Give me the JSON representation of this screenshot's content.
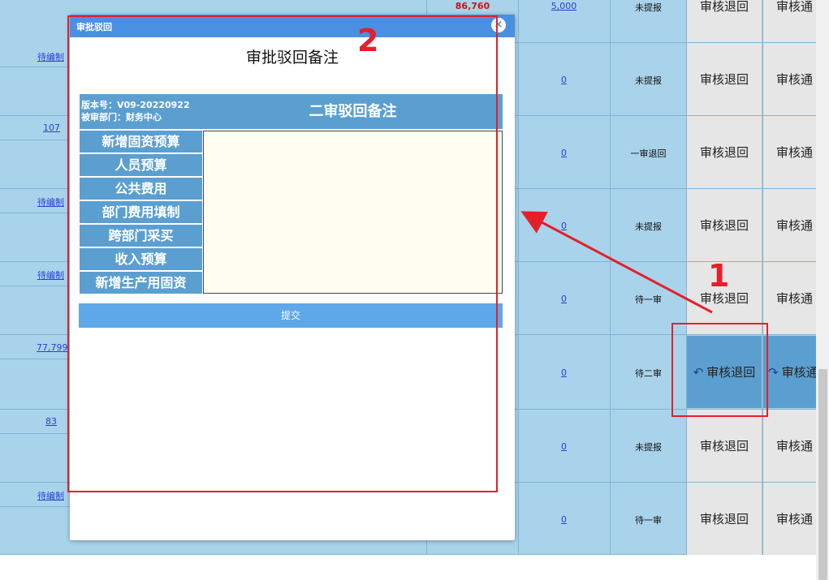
{
  "table": {
    "top_amount": "86,760",
    "top_amount_color": "#d01010",
    "left_links": [
      "待编制",
      "107",
      "待编制",
      "待编制",
      "77,799",
      "83",
      "待编制"
    ],
    "first_row_amount": "5,000",
    "row_amounts": [
      "0",
      "0",
      "0",
      "0",
      "0",
      "0",
      "0"
    ],
    "statuses": [
      "未提报",
      "未提报",
      "一审退回",
      "未提报",
      "待一审",
      "待二审",
      "未提报",
      "待一审"
    ],
    "reject_label": "审核退回",
    "pass_label": "审核通",
    "active_row_index": 5
  },
  "dialog": {
    "title": "审批驳回",
    "remark_title": "审批驳回备注",
    "version": "版本号：V09-20220922",
    "department": "被审部门：财务中心",
    "review_header": "二审驳回备注",
    "side_items": [
      "新增固资预算",
      "人员预算",
      "公共费用",
      "部门费用填制",
      "跨部门采买",
      "收入预算",
      "新增生产用固资"
    ],
    "submit_label": "提交",
    "remark_value": ""
  },
  "annotations": {
    "label_1": "1",
    "label_2": "2",
    "color": "#e3202a"
  }
}
